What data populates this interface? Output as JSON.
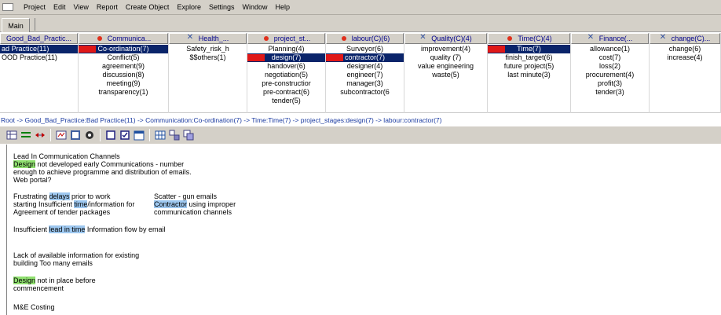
{
  "menu": [
    "Project",
    "Edit",
    "View",
    "Report",
    "Create Object",
    "Explore",
    "Settings",
    "Window",
    "Help"
  ],
  "tabs": {
    "main": "Main"
  },
  "columns": [
    {
      "header": "Good_Bad_Practic...",
      "icon": "none",
      "items": [
        "ad Practice(11)",
        "OOD Practice(11)"
      ],
      "selected": 0
    },
    {
      "header": "Communica...",
      "icon": "dot-icon",
      "items": [
        "Co-ordination(7)",
        "Conflict(5)",
        "agreement(9)",
        "discussion(8)",
        "meeting(9)",
        "transparency(1)"
      ],
      "selected": 0,
      "marker": 0
    },
    {
      "header": "Health_...",
      "icon": "x-icon",
      "items": [
        "Safety_risk_h",
        "$$others(1)"
      ]
    },
    {
      "header": "project_st...",
      "icon": "dot-icon",
      "items": [
        "Planning(4)",
        "design(7)",
        "handover(6)",
        "negotiation(5)",
        "pre-constructior",
        "pre-contract(6)",
        "tender(5)"
      ],
      "selected": 1,
      "marker": 1
    },
    {
      "header": "labour(C)(6)",
      "icon": "dot-icon",
      "items": [
        "Surveyor(6)",
        "contractor(7)",
        "designer(4)",
        "engineer(7)",
        "manager(3)",
        "subcontractor(6"
      ],
      "selected": 1,
      "marker": 1
    },
    {
      "header": "Quality(C)(4)",
      "icon": "x-icon",
      "items": [
        "improvement(4)",
        "quality (7)",
        "value engineering",
        "waste(5)"
      ]
    },
    {
      "header": "Time(C)(4)",
      "icon": "dot-icon",
      "items": [
        "Time(7)",
        "finish_target(6)",
        "future project(5)",
        "last minute(3)"
      ],
      "selected": 0,
      "marker": 0
    },
    {
      "header": "Finance(...",
      "icon": "x-icon",
      "items": [
        "allowance(1)",
        "cost(7)",
        "loss(2)",
        "procurement(4)",
        "profit(3)",
        "tender(3)"
      ]
    },
    {
      "header": "change(C)...",
      "icon": "x-icon",
      "items": [
        "change(6)",
        "increase(4)"
      ]
    }
  ],
  "path": "Root -> Good_Bad_Practice:Bad Practice(11) -> Communication:Co-ordination(7) -> Time:Time(7) -> project_stages:design(7) -> labour:contractor(7)",
  "text": {
    "l1": "Lead In   Communication Channels",
    "l2_hl": "Design",
    "l2_rest": " not developed early Communications - number",
    "l3": "enough to achieve programme and distribution of emails.",
    "l4": "Web portal?",
    "l5a": "Frustrating ",
    "l5_hl": "delays",
    "l5b": " prior to work",
    "l6a": "starting Insufficient ",
    "l6_hl": "time",
    "l6b": "/information for",
    "l7": "Agreement of tender packages",
    "r5": "Scatter - gun emails",
    "r6_hl": "Contractor",
    "r6b": " using improper",
    "r7": "communication channels",
    "l8a": "Insufficient ",
    "l8_hl": "lead in time",
    "l8b": " Information flow by email",
    "l9": "Lack of available information for existing",
    "l10": "building Too many emails",
    "l11_hl": "Design",
    "l11b": " not in place before",
    "l12": "commencement",
    "l13": "M&E Costing"
  },
  "colors": {
    "selected": "#0a246a",
    "marker": "#e01818",
    "highlight_green": "#90e070",
    "highlight_blue": "#9ec8f0",
    "path": "#1a3aa0"
  }
}
